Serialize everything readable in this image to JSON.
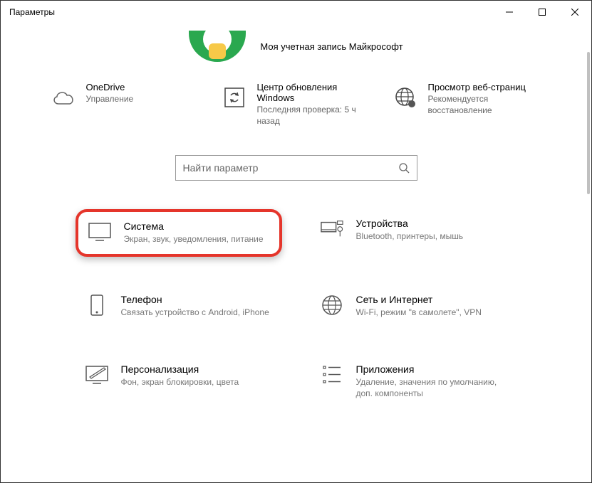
{
  "window": {
    "title": "Параметры"
  },
  "account": {
    "link_text": "Моя учетная запись Майкрософт"
  },
  "status": {
    "onedrive": {
      "title": "OneDrive",
      "sub": "Управление"
    },
    "update": {
      "title": "Центр обновления Windows",
      "sub": "Последняя проверка: 5 ч назад"
    },
    "web": {
      "title": "Просмотр веб-страниц",
      "sub": "Рекомендуется восстановление"
    }
  },
  "search": {
    "placeholder": "Найти параметр"
  },
  "categories": {
    "system": {
      "title": "Система",
      "sub": "Экран, звук, уведомления, питание"
    },
    "devices": {
      "title": "Устройства",
      "sub": "Bluetooth, принтеры, мышь"
    },
    "phone": {
      "title": "Телефон",
      "sub": "Связать устройство с Android, iPhone"
    },
    "network": {
      "title": "Сеть и Интернет",
      "sub": "Wi-Fi, режим \"в самолете\", VPN"
    },
    "personal": {
      "title": "Персонализация",
      "sub": "Фон, экран блокировки, цвета"
    },
    "apps": {
      "title": "Приложения",
      "sub": "Удаление, значения по умолчанию, доп. компоненты"
    }
  }
}
